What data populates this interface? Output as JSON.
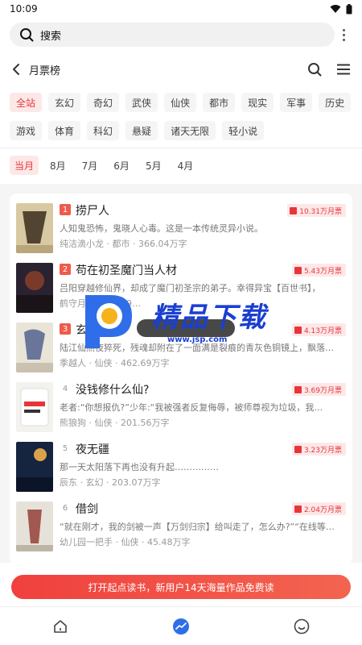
{
  "status_bar": {
    "time": "10:09"
  },
  "search": {
    "text": "搜索"
  },
  "nav": {
    "title": "月票榜"
  },
  "categories_row1": [
    "全站",
    "玄幻",
    "奇幻",
    "武侠",
    "仙侠",
    "都市",
    "现实",
    "军事",
    "历史"
  ],
  "categories_row2": [
    "游戏",
    "体育",
    "科幻",
    "悬疑",
    "诸天无限",
    "轻小说"
  ],
  "months": [
    "当月",
    "8月",
    "7月",
    "6月",
    "5月",
    "4月"
  ],
  "books": [
    {
      "rank": "1",
      "title": "捞尸人",
      "badge": "10.31万月票",
      "desc": "人知鬼恐怖，鬼晓人心毒。这是一本传统灵异小说。",
      "meta": "纯洁滴小龙 · 都市 · 366.04万字"
    },
    {
      "rank": "2",
      "title": "苟在初圣魔门当人材",
      "badge": "5.43万月票",
      "desc": "吕阳穿越修仙界，却成了魔门初圣宗的弟子。幸得异宝【百世书】，",
      "meta": "鹤守月 · 仙侠 · 19…"
    },
    {
      "rank": "3",
      "title": "玄鉴仙族",
      "badge": "4.13万月票",
      "desc": "陆江仙熬夜猝死，残魂却附在了一面满是裂痕的青灰色铜镜上，飘落…",
      "meta": "季越人 · 仙侠 · 462.69万字"
    },
    {
      "rank": "4",
      "title": "没钱修什么仙?",
      "badge": "3.69万月票",
      "desc": "老者:“你想报仇?”少年:“我被强者反复侮辱，被师尊视为垃圾，我…",
      "meta": "熊狼狗 · 仙侠 · 201.56万字"
    },
    {
      "rank": "5",
      "title": "夜无疆",
      "badge": "3.23万月票",
      "desc": "那一天太阳落下再也没有升起……………",
      "meta": "辰东 · 玄幻 · 203.07万字"
    },
    {
      "rank": "6",
      "title": "借剑",
      "badge": "2.04万月票",
      "desc": "“就在刚才，我的剑被一声【万剑归宗】给叫走了，怎么办?”“在线等…",
      "meta": "幼儿园一把手 · 仙侠 · 45.48万字"
    }
  ],
  "promo": {
    "text": "打开起点读书，新用户14天海量作品免费读"
  },
  "watermark": {
    "text": "精品下载",
    "url": "www.jsp.com"
  },
  "colors": {
    "accent": "#e8353a",
    "chip_bg": "#f5f5f5",
    "active_bg": "#fde8e8"
  }
}
